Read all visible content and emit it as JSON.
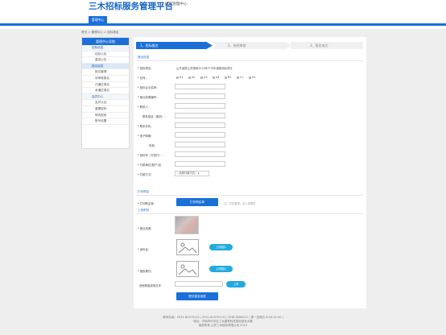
{
  "header": {
    "logo": "三木招标服务管理平台",
    "subtitle": "|   招投管理中心",
    "nav_tab": "管理中心"
  },
  "breadcrumb": "首页 > 管理中心 > 招标报名",
  "sidebar": {
    "title": "管理中心导航",
    "items": [
      {
        "label": "招标信息",
        "type": "sec"
      },
      {
        "label": "招标公告",
        "type": "item"
      },
      {
        "label": "重招公告",
        "type": "item"
      },
      {
        "label": "报名信息",
        "type": "active"
      },
      {
        "label": "报名管理",
        "type": "item"
      },
      {
        "label": "待审核报名",
        "type": "item"
      },
      {
        "label": "已通过报名",
        "type": "item"
      },
      {
        "label": "未通过报名",
        "type": "item"
      },
      {
        "label": "会员中心",
        "type": "sec"
      },
      {
        "label": "会员认证",
        "type": "item"
      },
      {
        "label": "重置密码",
        "type": "item"
      },
      {
        "label": "修改密码",
        "type": "item"
      },
      {
        "label": "账号设置",
        "type": "item"
      }
    ]
  },
  "steps": [
    "1、招标报名",
    "2、系统审核",
    "3、报名成功"
  ],
  "sections": {
    "info": "报名信息",
    "pay": "打印购买",
    "upload": "上传附件"
  },
  "form": {
    "project_label": "* 招标项目：",
    "project_value": "山东省国土资源局2019年下半年道路测绘项目",
    "package_label": "* 包号：",
    "packages": [
      "A1",
      "A2",
      "A3",
      "A4",
      "B1",
      "C1",
      "D1"
    ],
    "company_label": "* 投标企业名称：",
    "license_label": "* 营业执照编号：",
    "legal_label": "* 联系人：",
    "mobile_label": "联系电话（座机）：",
    "contact_label": "* 联系手机：",
    "email_label": "* 电子邮箱：",
    "fax_label": "传真：",
    "reason_label": "* 投标号（开发行）：",
    "bank_label": "* 付款单位(账户)名：",
    "invoice_label": "* 付款方式：",
    "invoice_select": "--请择付款方式--"
  },
  "pay": {
    "label": "* 打印购买单：",
    "button": "打印购买单",
    "hint": "注：打印盖章，并上传附件"
  },
  "upload": {
    "license_label": "* 营业执照：",
    "id_label": "* 身份证：",
    "id_button": "上传图片",
    "auth_label": "* 授权委托：",
    "auth_button": "上传图片",
    "other_label": "其他附属说明文件：",
    "other_button": "上传",
    "submit": "提交报名信息"
  },
  "footer": {
    "line1": "联系电话：0531-82979115 | 0531-82979115 | 0538-6068212 | 周一至周五 8:00-21:00 |",
    "line2": "地址：济南市市中区三木建筑科技招标投标大楼",
    "line3": "版权所有 山东三木招标有限公司 2019"
  }
}
